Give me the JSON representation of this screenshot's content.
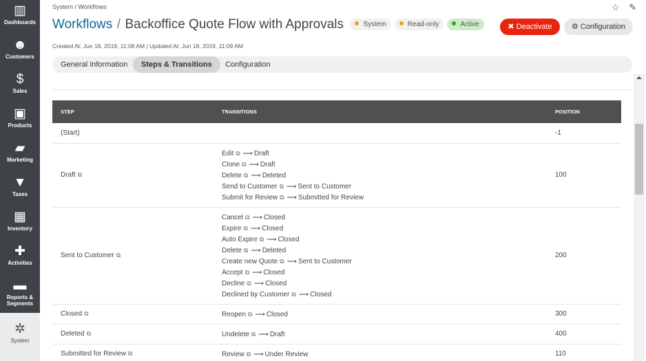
{
  "sidebar": {
    "items": [
      {
        "label": "Dashboards",
        "icon": "dashboards-icon",
        "glyph": "▥"
      },
      {
        "label": "Customers",
        "icon": "customers-icon",
        "glyph": "☻"
      },
      {
        "label": "Sales",
        "icon": "sales-icon",
        "glyph": "$"
      },
      {
        "label": "Products",
        "icon": "products-icon",
        "glyph": "▣"
      },
      {
        "label": "Marketing",
        "icon": "marketing-icon",
        "glyph": "▰"
      },
      {
        "label": "Taxes",
        "icon": "taxes-icon",
        "glyph": "▼"
      },
      {
        "label": "Inventory",
        "icon": "inventory-icon",
        "glyph": "▦"
      },
      {
        "label": "Activities",
        "icon": "activities-icon",
        "glyph": "✚"
      },
      {
        "label": "Reports & Segments",
        "icon": "reports-icon",
        "glyph": "▬"
      },
      {
        "label": "System",
        "icon": "system-icon",
        "glyph": "✲"
      }
    ]
  },
  "breadcrumb": "System / Workflows",
  "header": {
    "title_link": "Workflows",
    "separator": "/",
    "title": "Backoffice Quote Flow with Approvals",
    "badges": [
      {
        "label": "System",
        "color": "#e6a217"
      },
      {
        "label": "Read-only",
        "color": "#e6a217"
      },
      {
        "label": "Active",
        "color": "#3f9a22"
      }
    ],
    "deactivate_label": "✖ Deactivate",
    "configuration_label": "⚙ Configuration",
    "star_glyph": "☆",
    "pin_glyph": "✎"
  },
  "meta": "Created At: Jun 18, 2019, 11:08 AM  |  Updated At: Jun 18, 2019, 11:09 AM",
  "tabs": [
    {
      "label": "General Information"
    },
    {
      "label": "Steps & Transitions"
    },
    {
      "label": "Configuration"
    }
  ],
  "table": {
    "columns": [
      "STEP",
      "TRANSITIONS",
      "POSITION"
    ],
    "info_glyph": "⧉",
    "arrow": "⟶",
    "rows": [
      {
        "step": "(Start)",
        "info": false,
        "transitions": [],
        "position": "-1"
      },
      {
        "step": "Draft",
        "info": true,
        "position": "100",
        "transitions": [
          {
            "name": "Edit",
            "target": "Draft"
          },
          {
            "name": "Clone",
            "target": "Draft"
          },
          {
            "name": "Delete",
            "target": "Deleted"
          },
          {
            "name": "Send to Customer",
            "target": "Sent to Customer"
          },
          {
            "name": "Submit for Review",
            "target": "Submitted for Review"
          }
        ]
      },
      {
        "step": "Sent to Customer",
        "info": true,
        "position": "200",
        "transitions": [
          {
            "name": "Cancel",
            "target": "Closed"
          },
          {
            "name": "Expire",
            "target": "Closed"
          },
          {
            "name": "Auto Expire",
            "target": "Closed"
          },
          {
            "name": "Delete",
            "target": "Deleted"
          },
          {
            "name": "Create new Quote",
            "target": "Sent to Customer"
          },
          {
            "name": "Accept",
            "target": "Closed"
          },
          {
            "name": "Decline",
            "target": "Closed"
          },
          {
            "name": "Declined by Customer",
            "target": "Closed"
          }
        ]
      },
      {
        "step": "Closed",
        "info": true,
        "position": "300",
        "transitions": [
          {
            "name": "Reopen",
            "target": "Closed"
          }
        ]
      },
      {
        "step": "Deleted",
        "info": true,
        "position": "400",
        "transitions": [
          {
            "name": "Undelete",
            "target": "Draft"
          }
        ]
      },
      {
        "step": "Submitted for Review",
        "info": true,
        "position": "110",
        "transitions": [
          {
            "name": "Review",
            "target": "Under Review"
          }
        ]
      }
    ]
  }
}
